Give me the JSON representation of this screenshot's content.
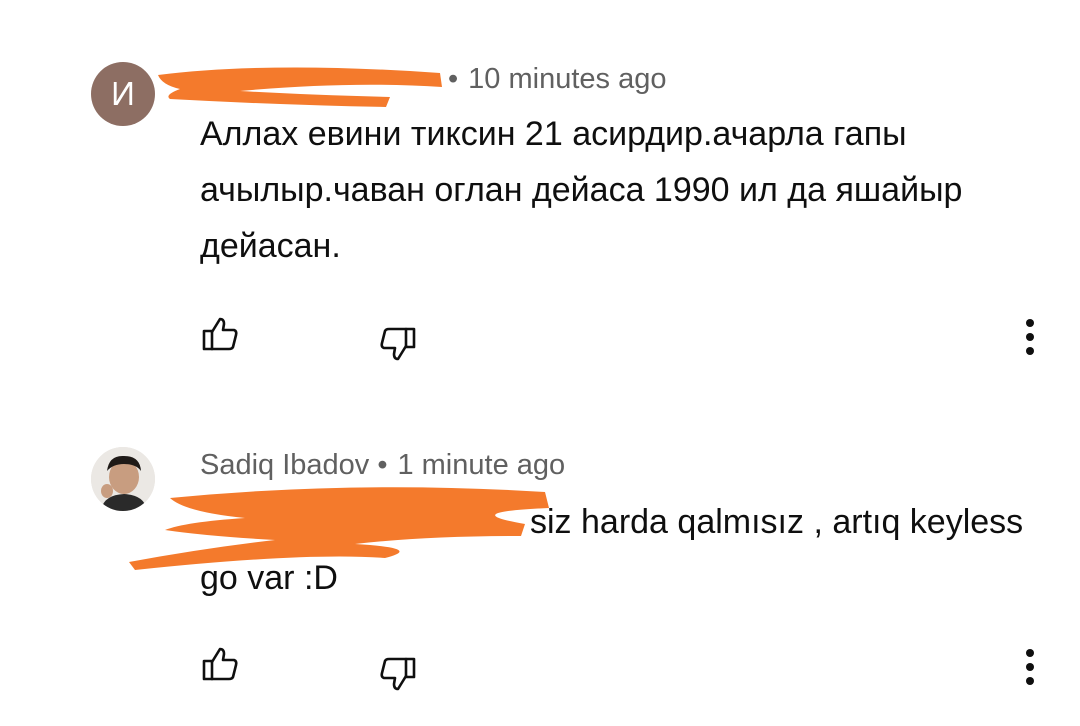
{
  "comments": [
    {
      "avatar_letter": "И",
      "author": "",
      "separator": "•",
      "time": "10 minutes ago",
      "text": "Аллах евини тиксин 21 асирдир.ачарла гапы ачылыр.чаван оглан дейаса 1990 ил да яшайыр дейасан.",
      "like_icon": "thumb-up-icon",
      "dislike_icon": "thumb-down-icon",
      "more_icon": "more-vertical-icon"
    },
    {
      "author": "Sadiq Ibadov",
      "separator": "•",
      "time": "1 minute ago",
      "text": "siz harda qalmısız , artıq keyless go var :D",
      "like_icon": "thumb-up-icon",
      "dislike_icon": "thumb-down-icon",
      "more_icon": "more-vertical-icon"
    }
  ],
  "colors": {
    "background": "#ffffff",
    "text": "#0f0f0f",
    "meta": "#606060",
    "avatar_letter_bg": "#8d6e63",
    "redaction": "#f47a2c"
  }
}
